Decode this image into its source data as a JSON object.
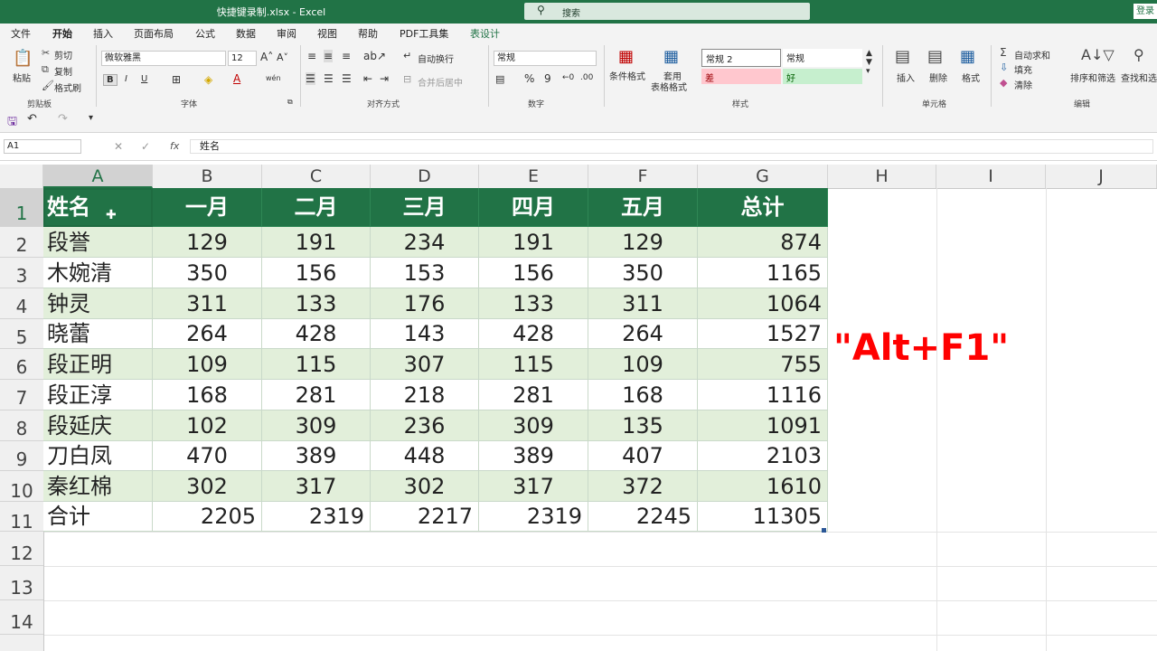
{
  "window": {
    "title": "快捷键录制.xlsx  -  Excel",
    "search_placeholder": "搜索",
    "signin_label": "登录"
  },
  "tabs": [
    {
      "label": "文件"
    },
    {
      "label": "开始"
    },
    {
      "label": "插入"
    },
    {
      "label": "页面布局"
    },
    {
      "label": "公式"
    },
    {
      "label": "数据"
    },
    {
      "label": "审阅"
    },
    {
      "label": "视图"
    },
    {
      "label": "帮助"
    },
    {
      "label": "PDF工具集"
    },
    {
      "label": "表设计"
    }
  ],
  "ribbon": {
    "clipboard": {
      "paste": "粘贴",
      "cut": "剪切",
      "copy": "复制",
      "format_painter": "格式刷",
      "label": "剪贴板"
    },
    "font": {
      "name": "微软雅黑",
      "size": "12",
      "label": "字体"
    },
    "alignment": {
      "wrap": "自动换行",
      "merge": "合并后居中",
      "label": "对齐方式"
    },
    "number": {
      "format": "常规",
      "label": "数字"
    },
    "styles": {
      "conditional": "条件格式",
      "table_line1": "套用",
      "table_line2": "表格格式",
      "normal2": "常规 2",
      "normal": "常规",
      "bad": "差",
      "good": "好",
      "label": "样式"
    },
    "cells": {
      "insert": "插入",
      "delete": "删除",
      "format": "格式",
      "label": "单元格"
    },
    "editing": {
      "autosum": "自动求和",
      "fill": "填充",
      "clear": "清除",
      "sort": "排序和筛选",
      "find": "查找和选",
      "label": "编辑"
    }
  },
  "formula_bar": {
    "name_box": "A1",
    "fx": "fx",
    "value": "姓名"
  },
  "columns": [
    "A",
    "B",
    "C",
    "D",
    "E",
    "F",
    "G",
    "H",
    "I",
    "J"
  ],
  "rows": [
    "1",
    "2",
    "3",
    "4",
    "5",
    "6",
    "7",
    "8",
    "9",
    "10",
    "11",
    "12",
    "13",
    "14"
  ],
  "table": {
    "headers": [
      "姓名",
      "一月",
      "二月",
      "三月",
      "四月",
      "五月",
      "总计"
    ],
    "data": [
      [
        "段誉",
        "129",
        "191",
        "234",
        "191",
        "129",
        "874"
      ],
      [
        "木婉清",
        "350",
        "156",
        "153",
        "156",
        "350",
        "1165"
      ],
      [
        "钟灵",
        "311",
        "133",
        "176",
        "133",
        "311",
        "1064"
      ],
      [
        "晓蕾",
        "264",
        "428",
        "143",
        "428",
        "264",
        "1527"
      ],
      [
        "段正明",
        "109",
        "115",
        "307",
        "115",
        "109",
        "755"
      ],
      [
        "段正淳",
        "168",
        "281",
        "218",
        "281",
        "168",
        "1116"
      ],
      [
        "段延庆",
        "102",
        "309",
        "236",
        "309",
        "135",
        "1091"
      ],
      [
        "刀白凤",
        "470",
        "389",
        "448",
        "389",
        "407",
        "2103"
      ],
      [
        "秦红棉",
        "302",
        "317",
        "302",
        "317",
        "372",
        "1610"
      ]
    ],
    "total_row": [
      "合计",
      "2205",
      "2319",
      "2217",
      "2319",
      "2245",
      "11305"
    ]
  },
  "annotation": "\"Alt+F1\"",
  "colors": {
    "excel_green": "#217346",
    "band": "#e2efda",
    "annotation": "#ff0000"
  }
}
